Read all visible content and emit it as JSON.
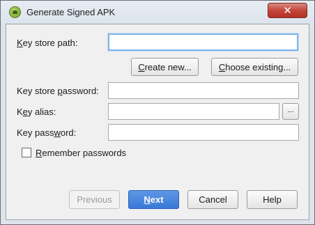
{
  "window": {
    "title": "Generate Signed APK",
    "close_glyph": "✕",
    "app_icon": "android-icon"
  },
  "form": {
    "keystore_path": {
      "label_u": "K",
      "label_rest": "ey store path:",
      "value": ""
    },
    "create_new": {
      "label_u": "C",
      "label_rest": "reate new..."
    },
    "choose_existing": {
      "label_u": "C",
      "label_rest": "hoose existing..."
    },
    "keystore_password": {
      "label_pre": "Key store ",
      "label_u": "p",
      "label_rest": "assword:",
      "value": ""
    },
    "key_alias": {
      "label_pre": "K",
      "label_u": "e",
      "label_rest": "y alias:",
      "value": "",
      "browse_glyph": "..."
    },
    "key_password": {
      "label_pre": "Key pass",
      "label_u": "w",
      "label_rest": "ord:",
      "value": ""
    },
    "remember": {
      "label_u": "R",
      "label_rest": "emember passwords",
      "checked": false
    }
  },
  "footer": {
    "previous": "Previous",
    "next_u": "N",
    "next_rest": "ext",
    "cancel": "Cancel",
    "help": "Help"
  }
}
